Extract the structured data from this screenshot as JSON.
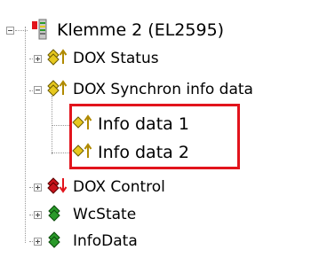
{
  "tree": {
    "root": {
      "label": "Klemme 2 (EL2595)",
      "icon": "terminal-icon",
      "expanded": true
    },
    "items": [
      {
        "label": "DOX Status",
        "icon": "input-vars-icon",
        "expanded": false
      },
      {
        "label": "DOX Synchron info data",
        "icon": "input-vars-icon",
        "expanded": true,
        "children": [
          {
            "label": "Info data 1",
            "icon": "input-var-icon"
          },
          {
            "label": "Info data 2",
            "icon": "input-var-icon"
          }
        ]
      },
      {
        "label": "DOX Control",
        "icon": "output-vars-icon",
        "expanded": false
      },
      {
        "label": "WcState",
        "icon": "status-vars-icon",
        "expanded": false
      },
      {
        "label": "InfoData",
        "icon": "status-vars-icon",
        "expanded": false
      }
    ]
  },
  "colors": {
    "highlight_border": "#e2141c",
    "input_yellow": "#e6c81e",
    "output_red": "#c8141c",
    "status_green": "#2a9a2a"
  }
}
